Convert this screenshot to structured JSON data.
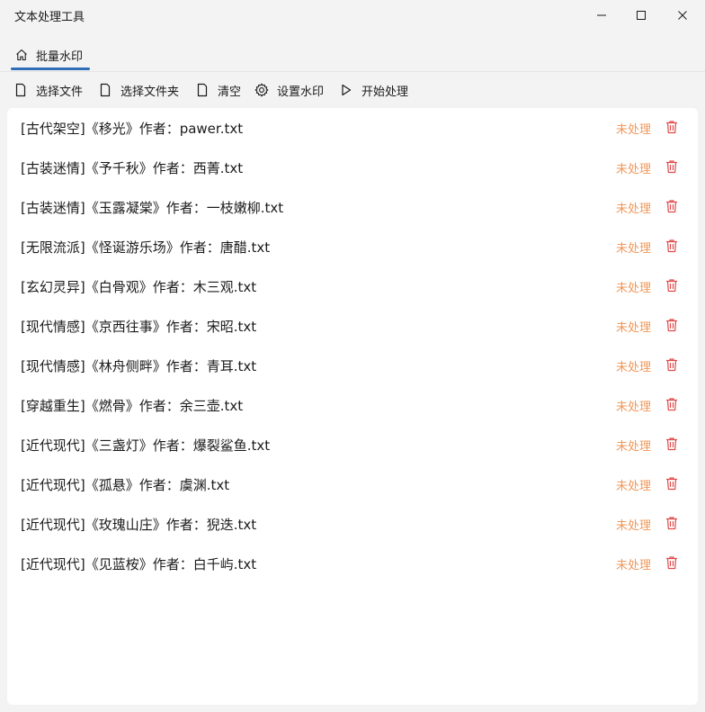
{
  "window": {
    "title": "文本处理工具"
  },
  "tab": {
    "label": "批量水印",
    "icon": "home-icon",
    "accent": "#2f6db7"
  },
  "toolbar": {
    "select_file": "选择文件",
    "select_folder": "选择文件夹",
    "clear": "清空",
    "set_watermark": "设置水印",
    "start": "开始处理"
  },
  "status_color": "#f0985a",
  "delete_color": "#e04b4b",
  "files": [
    {
      "name": "[古代架空]《移光》作者：pawer.txt",
      "status": "未处理"
    },
    {
      "name": "[古装迷情]《予千秋》作者：西菁.txt",
      "status": "未处理"
    },
    {
      "name": "[古装迷情]《玉露凝棠》作者：一枝嫩柳.txt",
      "status": "未处理"
    },
    {
      "name": "[无限流派]《怪诞游乐场》作者：唐醋.txt",
      "status": "未处理"
    },
    {
      "name": "[玄幻灵异]《白骨观》作者：木三观.txt",
      "status": "未处理"
    },
    {
      "name": "[现代情感]《京西往事》作者：宋昭.txt",
      "status": "未处理"
    },
    {
      "name": "[现代情感]《林舟侧畔》作者：青耳.txt",
      "status": "未处理"
    },
    {
      "name": "[穿越重生]《燃骨》作者：余三壶.txt",
      "status": "未处理"
    },
    {
      "name": "[近代现代]《三盏灯》作者：爆裂鲨鱼.txt",
      "status": "未处理"
    },
    {
      "name": "[近代现代]《孤悬》作者：虞渊.txt",
      "status": "未处理"
    },
    {
      "name": "[近代现代]《玫瑰山庄》作者：猊迭.txt",
      "status": "未处理"
    },
    {
      "name": "[近代现代]《见蓝桉》作者：白千屿.txt",
      "status": "未处理"
    }
  ]
}
